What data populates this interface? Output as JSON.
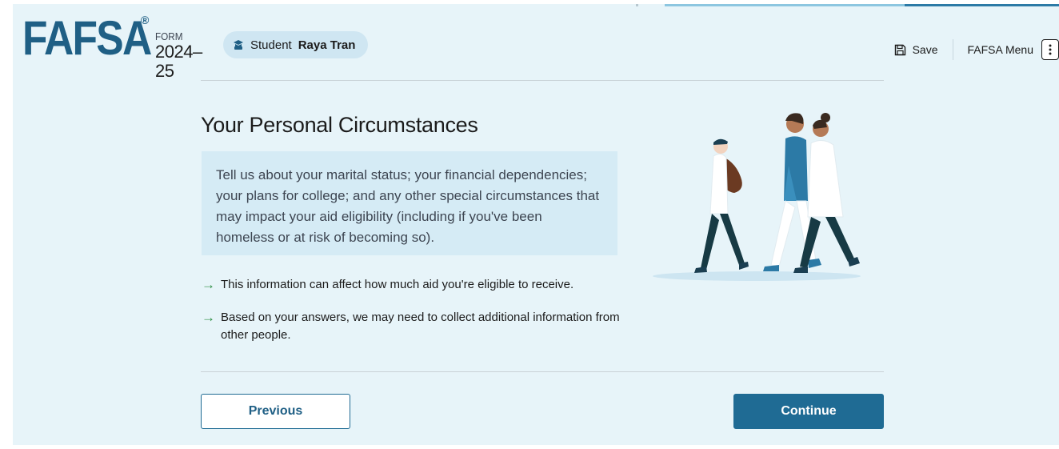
{
  "header": {
    "brand": "FAFSA",
    "brand_reg": "®",
    "form_label": "FORM",
    "form_year": "2024–25",
    "student_prefix": "Student",
    "student_name": "Raya Tran",
    "save_label": "Save",
    "menu_label": "FAFSA Menu"
  },
  "main": {
    "title": "Your Personal Circumstances",
    "callout": "Tell us about your marital status; your financial dependencies; your plans for college; and any other special circumstances that may impact your aid eligibility (including if you've been homeless or at risk of becoming so).",
    "bullets": [
      "This information can affect how much aid you're eligible to receive.",
      "Based on your answers, we may need to collect additional information from other people."
    ]
  },
  "nav": {
    "previous_label": "Previous",
    "continue_label": "Continue"
  },
  "icons": {
    "student": "graduation-cap-icon",
    "save": "floppy-disk-icon",
    "menu": "kebab-menu-icon",
    "bullet": "arrow-right-icon"
  },
  "colors": {
    "brand": "#1f5f85",
    "page_bg": "#e7f4f9",
    "callout_bg": "#d5ebf5",
    "primary_button": "#1f6b94",
    "arrow": "#2f8f46"
  }
}
